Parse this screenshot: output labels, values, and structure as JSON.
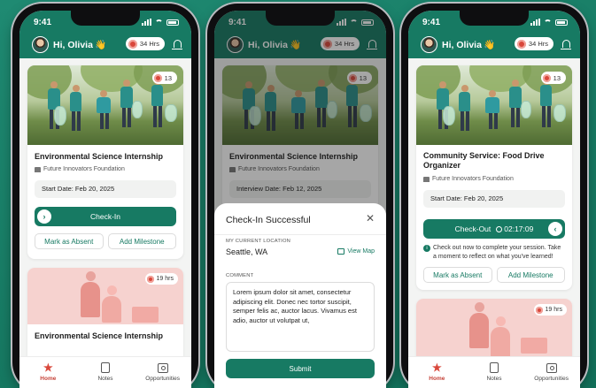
{
  "status_time": "9:41",
  "header": {
    "greeting": "Hi, Olivia",
    "wave": "👋",
    "hours": "34 Hrs"
  },
  "tabs": {
    "home": "Home",
    "notes": "Notes",
    "opportunities": "Opportunities"
  },
  "phone1": {
    "card1": {
      "badge_count": "13",
      "title": "Environmental Science Internship",
      "org": "Future Innovators Foundation",
      "date": "Start Date: Feb 20, 2025",
      "checkin_label": "Check-In",
      "absent_label": "Mark as Absent",
      "milestone_label": "Add Milestone"
    },
    "card2": {
      "hrs": "19 hrs",
      "title": "Environmental Science Internship"
    }
  },
  "phone2": {
    "card1": {
      "badge_count": "13",
      "title": "Environmental Science Internship",
      "org": "Future Innovators Foundation",
      "date": "Interview Date: Feb 12, 2025"
    },
    "sheet": {
      "title": "Check-In Successful",
      "location_label": "MY CURRENT LOCATION",
      "location_value": "Seattle, WA",
      "view_map": "View Map",
      "comment_label": "COMMENT",
      "comment_text": "Lorem ipsum dolor sit amet, consectetur adipiscing elit. Donec nec tortor suscipit, semper felis ac, auctor lacus. Vivamus est adio, auctor ut volutpat ut,",
      "submit_label": "Submit"
    }
  },
  "phone3": {
    "card1": {
      "badge_count": "13",
      "title": "Community Service: Food Drive Organizer",
      "org": "Future Innovators Foundation",
      "date": "Start Date: Feb 20, 2025",
      "checkout_label": "Check-Out",
      "timer": "02:17:09",
      "hint": "Check out now to complete your session. Take a moment to reflect on what you've learned!",
      "absent_label": "Mark as Absent",
      "milestone_label": "Add Milestone"
    },
    "card2": {
      "hrs": "19 hrs"
    }
  },
  "colors": {
    "brand": "#177a63",
    "accent_red": "#d9473b",
    "background": "#1f8a72"
  },
  "icons": [
    "avatar",
    "bell-icon",
    "home-star-icon",
    "notes-icon",
    "opportunities-icon",
    "close-icon",
    "map-icon",
    "timer-icon",
    "info-icon",
    "arrow-right-icon",
    "arrow-left-icon"
  ]
}
